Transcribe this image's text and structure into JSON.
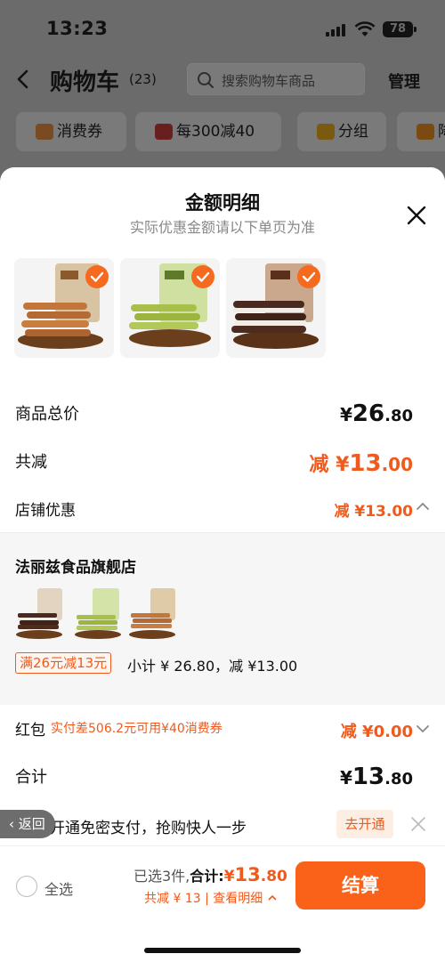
{
  "status_bar": {
    "time": "13:23",
    "battery": "78"
  },
  "header": {
    "title": "购物车",
    "count": "(23)",
    "search_placeholder": "搜索购物车商品",
    "manage": "管理",
    "chips": [
      "消费券",
      "每300减40",
      "分组",
      "降"
    ]
  },
  "sheet": {
    "title": "金额明细",
    "subtitle": "实际优惠金额请以下单页为准",
    "total_label": "商品总价",
    "total_symbol": "¥",
    "total_int": "26",
    "total_dec": ".80",
    "reduce_label": "共减",
    "reduce_prefix": "减 ¥",
    "reduce_int": "13",
    "reduce_dec": ".00",
    "store_discount_label": "店铺优惠",
    "store_discount_prefix": "减 ¥",
    "store_discount_int": "13",
    "store_discount_dec": ".00",
    "store": {
      "name": "法丽兹食品旗舰店",
      "promo_tag": "满26元减13元",
      "subtotal": "小计 ¥ 26.80，减 ¥13.00"
    },
    "redpacket_label": "红包",
    "redpacket_note": "实付差506.2元可用¥40消费券",
    "redpacket_prefix": "减 ¥",
    "redpacket_int": "0",
    "redpacket_dec": ".00",
    "sum_label": "合计",
    "sum_symbol": "¥",
    "sum_int": "13",
    "sum_dec": ".80"
  },
  "toast": {
    "back_label": "返回",
    "text": "开通免密支付，抢购快人一步",
    "action": "去开通"
  },
  "bottom_bar": {
    "select_all": "全选",
    "selected_text": "已选3件,",
    "total_label": "合计:",
    "total_symbol": "¥",
    "total_int": "13",
    "total_dec": ".80",
    "reduce_detail": "共减 ¥ 13 | 查看明细",
    "checkout": "结算"
  },
  "colors": {
    "accent": "#f05a1c",
    "checkout": "#f96218",
    "dim_overlay": "#6b6b6b"
  },
  "icons": [
    "back-arrow-icon",
    "search-icon",
    "close-icon",
    "check-icon",
    "chevron-up-icon",
    "chevron-down-icon",
    "shield-icon",
    "radio-icon"
  ]
}
